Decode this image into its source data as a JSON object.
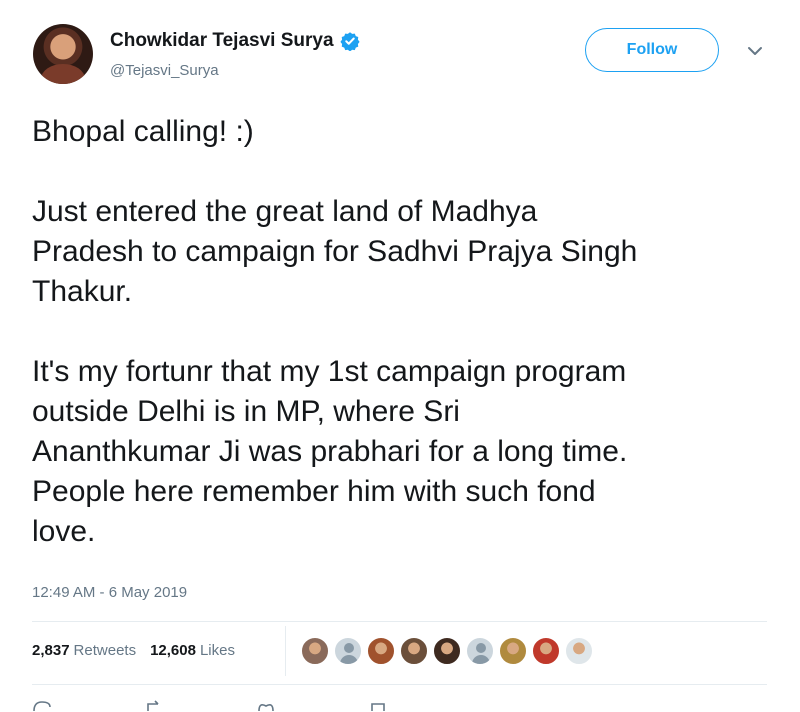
{
  "author": {
    "display_name": "Chowkidar Tejasvi Surya",
    "handle": "@Tejasvi_Surya",
    "verified_icon": "verified-badge-icon"
  },
  "follow_button": {
    "label": "Follow"
  },
  "caret_icon": "chevron-down-icon",
  "tweet": {
    "text": "Bhopal calling! :)\n\nJust entered the great land of Madhya\nPradesh to campaign for Sadhvi Prajya Singh\nThakur.\n\nIt's my fortunr that my 1st campaign program\noutside Delhi is in MP, where Sri\nAnanthkumar Ji was prabhari for a long time.\nPeople here remember him with such fond\nlove.",
    "timestamp": "12:49 AM - 6 May 2019"
  },
  "stats": {
    "retweets_count": "2,837",
    "retweets_label": "Retweets",
    "likes_count": "12,608",
    "likes_label": "Likes"
  },
  "likers": [
    {
      "color": "#8a6a5a"
    },
    {
      "color": "default"
    },
    {
      "color": "#a0522d"
    },
    {
      "color": "#6b4f3a"
    },
    {
      "color": "#3e2a20"
    },
    {
      "color": "default"
    },
    {
      "color": "#b08a3e"
    },
    {
      "color": "#c0392b"
    },
    {
      "color": "#dfe6ea"
    }
  ],
  "colors": {
    "accent": "#1da1f2",
    "muted": "#657786",
    "text": "#14171a"
  }
}
